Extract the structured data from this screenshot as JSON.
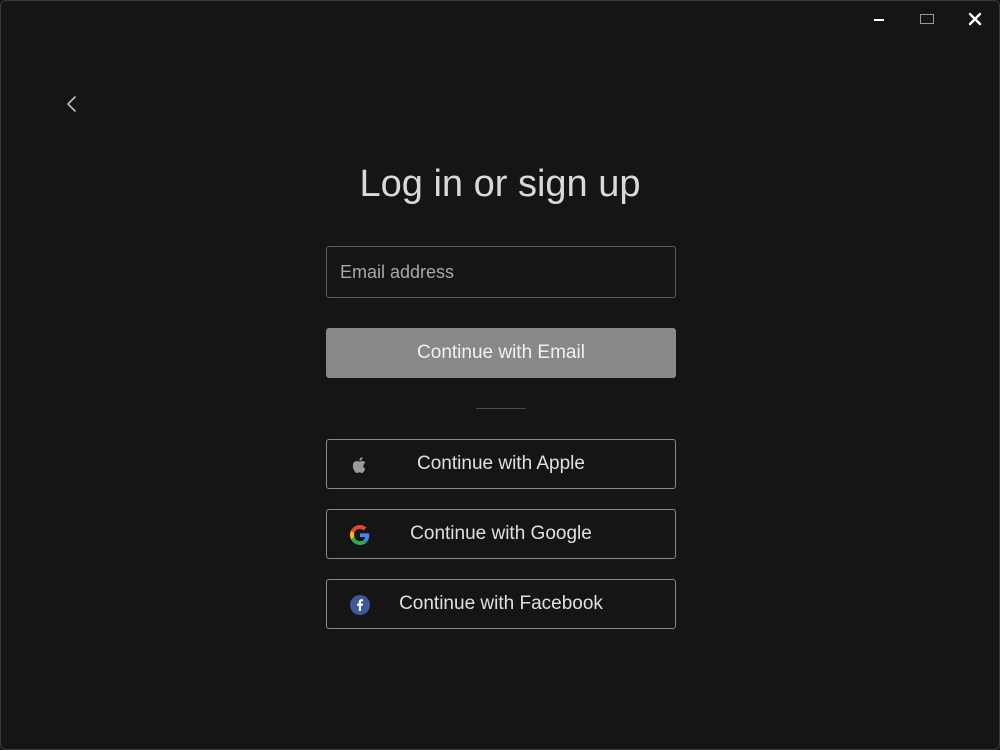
{
  "window": {
    "controls": {
      "minimize_icon": "minimize-icon",
      "maximize_icon": "maximize-icon",
      "close_icon": "close-icon"
    },
    "back_icon": "chevron-left-icon"
  },
  "main": {
    "title": "Log in or sign up",
    "email_input": {
      "value": "",
      "placeholder": "Email address"
    },
    "continue_email_label": "Continue with Email",
    "providers": [
      {
        "label": "Continue with Apple",
        "icon": "apple-icon"
      },
      {
        "label": "Continue with Google",
        "icon": "google-icon"
      },
      {
        "label": "Continue with Facebook",
        "icon": "facebook-icon"
      }
    ]
  },
  "colors": {
    "background": "#151515",
    "primary_button": "#888888",
    "text": "#d9d9d9",
    "border": "#8a8a8a",
    "facebook_blue": "#3b5998"
  }
}
